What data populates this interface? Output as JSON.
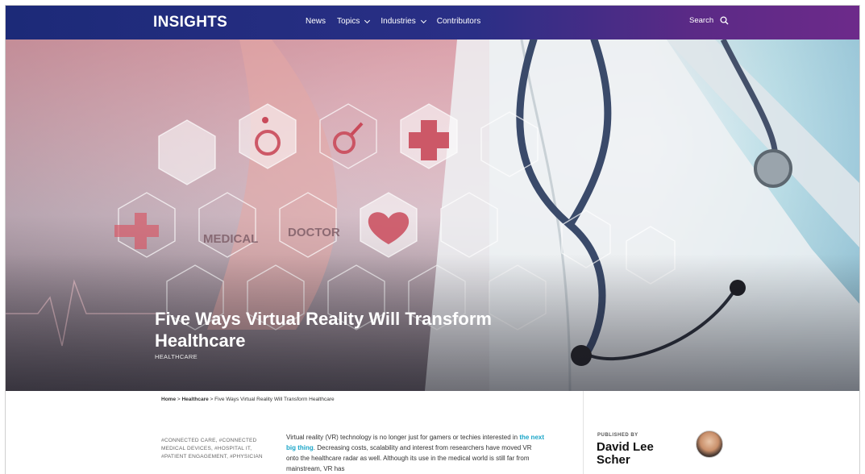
{
  "nav": {
    "brand": "INSIGHTS",
    "links": [
      {
        "label": "News",
        "has_dropdown": false
      },
      {
        "label": "Topics",
        "has_dropdown": true
      },
      {
        "label": "Industries",
        "has_dropdown": true
      },
      {
        "label": "Contributors",
        "has_dropdown": false
      }
    ],
    "search_label": "Search",
    "search_icon": "search-icon"
  },
  "hero": {
    "title": "Five Ways Virtual Reality Will Transform Healthcare",
    "category": "HEALTHCARE",
    "icon_words": [
      "MEDICAL",
      "DOCTOR"
    ]
  },
  "breadcrumb": {
    "home": "Home",
    "section": "Healthcare",
    "current": "Five Ways Virtual Reality Will Transform Healthcare",
    "separator": ">"
  },
  "tags": {
    "text": "#CONNECTED CARE, #CONNECTED MEDICAL DEVICES, #HOSPITAL IT, #PATIENT ENGAGEMENT, #PHYSICIAN"
  },
  "article": {
    "p1_before": "Virtual reality (VR) technology is no longer just for gamers or techies interested in ",
    "p1_link": "the next big thing",
    "p1_after": ". Decreasing costs, scalability and interest from researchers have moved VR onto the healthcare radar as well. Although its use in the medical world is still far from mainstream, VR has"
  },
  "sidebar": {
    "published_by_label": "PUBLISHED BY",
    "author_name": "David Lee Scher"
  },
  "colors": {
    "nav_start": "#1c2a78",
    "nav_end": "#6d2a8a",
    "link": "#1aa5c8"
  }
}
